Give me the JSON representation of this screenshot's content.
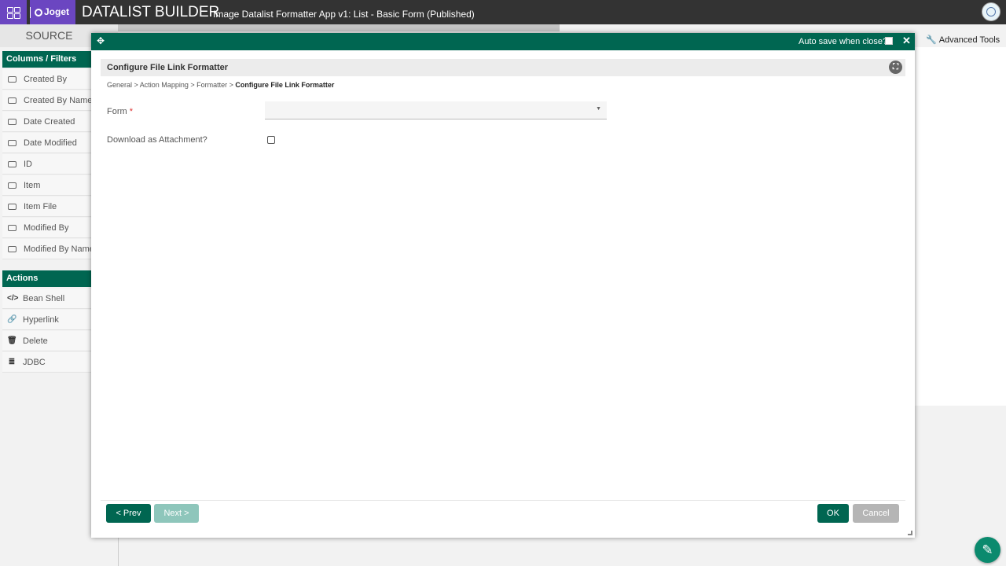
{
  "topbar": {
    "logo": "Joget",
    "title": "DATALIST BUILDER",
    "subtitle": "Image Datalist Formatter App v1: List - Basic Form (Published)"
  },
  "source_tab": "SOURCE",
  "advanced_tools": "Advanced Tools",
  "sidebar": {
    "columns_heading": "Columns / Filters",
    "columns": [
      "Created By",
      "Created By Name",
      "Date Created",
      "Date Modified",
      "ID",
      "Item",
      "Item File",
      "Modified By",
      "Modified By Name"
    ],
    "actions_heading": "Actions",
    "actions": [
      {
        "label": "Bean Shell",
        "icon": "code-icon"
      },
      {
        "label": "Hyperlink",
        "icon": "link-icon"
      },
      {
        "label": "Delete",
        "icon": "trash-icon"
      },
      {
        "label": "JDBC",
        "icon": "database-icon"
      }
    ]
  },
  "modal": {
    "autosave_label": "Auto save when close?",
    "autosave_checked": false,
    "title": "Configure File Link Formatter",
    "breadcrumb": [
      "General",
      "Action Mapping",
      "Formatter",
      "Configure File Link Formatter"
    ],
    "form_label": "Form",
    "form_required": "*",
    "form_value": "",
    "download_label": "Download as Attachment?",
    "download_checked": false,
    "prev_label": "< Prev",
    "next_label": "Next >",
    "ok_label": "OK",
    "cancel_label": "Cancel"
  },
  "colors": {
    "primary": "#006651",
    "topbar": "#333333",
    "brand": "#6b46c1",
    "disabled": "#8ec6bb"
  }
}
